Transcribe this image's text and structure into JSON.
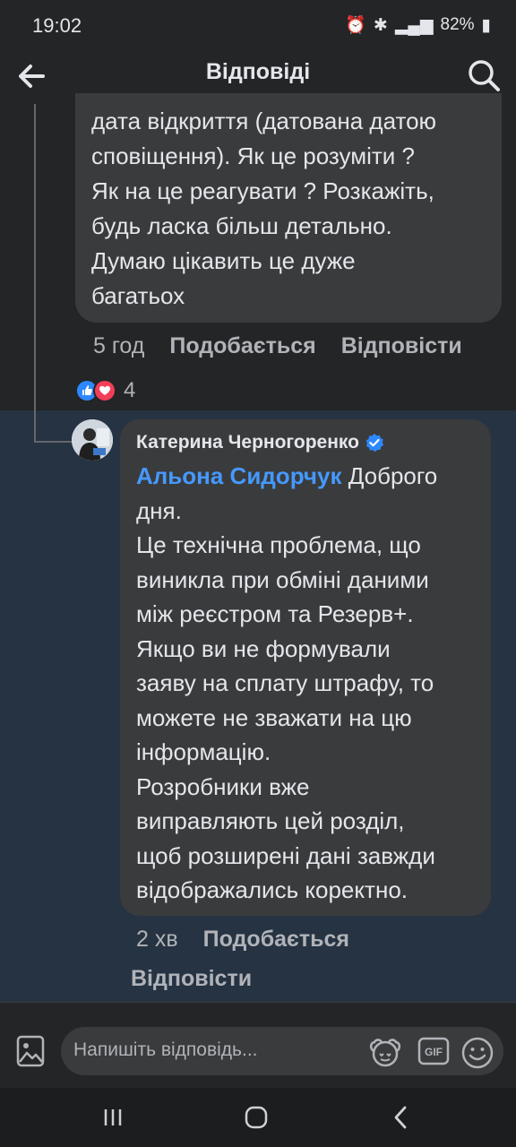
{
  "status_bar": {
    "time": "19:02",
    "battery": "82%"
  },
  "header": {
    "title": "Відповіді"
  },
  "parent_comment": {
    "text": "дата відкриття (датована датою\nсповіщення). Як це розуміти ?\nЯк на це реагувати ? Розкажіть,\nбудь ласка більш детально.\nДумаю цікавить це дуже\nбагатьох",
    "time": "5 год",
    "like_label": "Подобається",
    "reply_label": "Відповісти",
    "reaction_count": "4"
  },
  "reply_comment": {
    "author": "Катерина Черногоренко",
    "mention": "Альона Сидорчук",
    "text_after_mention": " Доброго\nдня.\nЦе технічна проблема, що\nвиникла при обміні даними\nміж реєстром та Резерв+.\nЯкщо ви не формували\nзаяву на сплату штрафу, то\nможете не зважати на цю\nінформацію.\nРозробники вже\nвиправляють цей розділ,\nщоб розширені дані завжди\nвідображались коректно.",
    "time": "2 хв",
    "like_label": "Подобається",
    "reply_label": "Відповісти"
  },
  "composer": {
    "placeholder": "Напишіть відповідь..."
  },
  "colors": {
    "accent": "#4599ff",
    "background": "#242526",
    "bubble": "#3a3b3c",
    "highlight": "#263343"
  }
}
